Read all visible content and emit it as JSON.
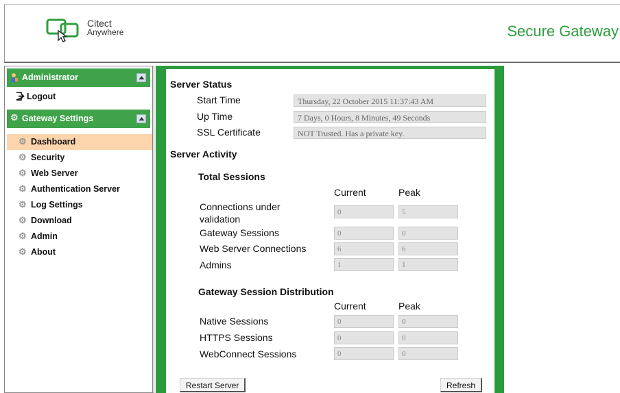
{
  "header": {
    "logo_line1": "Citect",
    "logo_line2": "Anywhere",
    "product_title": "Secure Gateway"
  },
  "sidebar": {
    "admin_panel_title": "Administrator",
    "logout_label": "Logout",
    "settings_panel_title": "Gateway Settings",
    "items": [
      {
        "label": "Dashboard",
        "active": true
      },
      {
        "label": "Security"
      },
      {
        "label": "Web Server"
      },
      {
        "label": "Authentication Server"
      },
      {
        "label": "Log Settings"
      },
      {
        "label": "Download"
      },
      {
        "label": "Admin"
      },
      {
        "label": "About"
      }
    ]
  },
  "server_status": {
    "title": "Server Status",
    "start_time_label": "Start Time",
    "start_time_value": "Thursday, 22 October 2015 11:37:43 AM",
    "up_time_label": "Up Time",
    "up_time_value": "7 Days, 0 Hours, 8 Minutes, 49 Seconds",
    "ssl_label": "SSL Certificate",
    "ssl_value": "NOT Trusted. Has a private key."
  },
  "server_activity": {
    "title": "Server Activity",
    "total_sessions": {
      "title": "Total Sessions",
      "col_current": "Current",
      "col_peak": "Peak",
      "rows": [
        {
          "label_line1": "Connections under",
          "label_line2": "validation",
          "current": "0",
          "peak": "5"
        },
        {
          "label": "Gateway Sessions",
          "current": "0",
          "peak": "0"
        },
        {
          "label": "Web Server Connections",
          "current": "6",
          "peak": "6"
        },
        {
          "label": "Admins",
          "current": "1",
          "peak": "1"
        }
      ]
    },
    "distribution": {
      "title": "Gateway Session Distribution",
      "col_current": "Current",
      "col_peak": "Peak",
      "rows": [
        {
          "label": "Native Sessions",
          "current": "0",
          "peak": "0"
        },
        {
          "label": "HTTPS Sessions",
          "current": "0",
          "peak": "0"
        },
        {
          "label": "WebConnect Sessions",
          "current": "0",
          "peak": "0"
        }
      ]
    }
  },
  "buttons": {
    "restart": "Restart Server",
    "refresh": "Refresh"
  },
  "colors": {
    "accent_green": "#3fa34a",
    "title_green": "#2e9f3c",
    "active_item": "#fcd5ac"
  },
  "icons": [
    "citect-anywhere-logo",
    "admin-user-icon",
    "logout-icon",
    "gear-icon",
    "collapse-icon"
  ]
}
